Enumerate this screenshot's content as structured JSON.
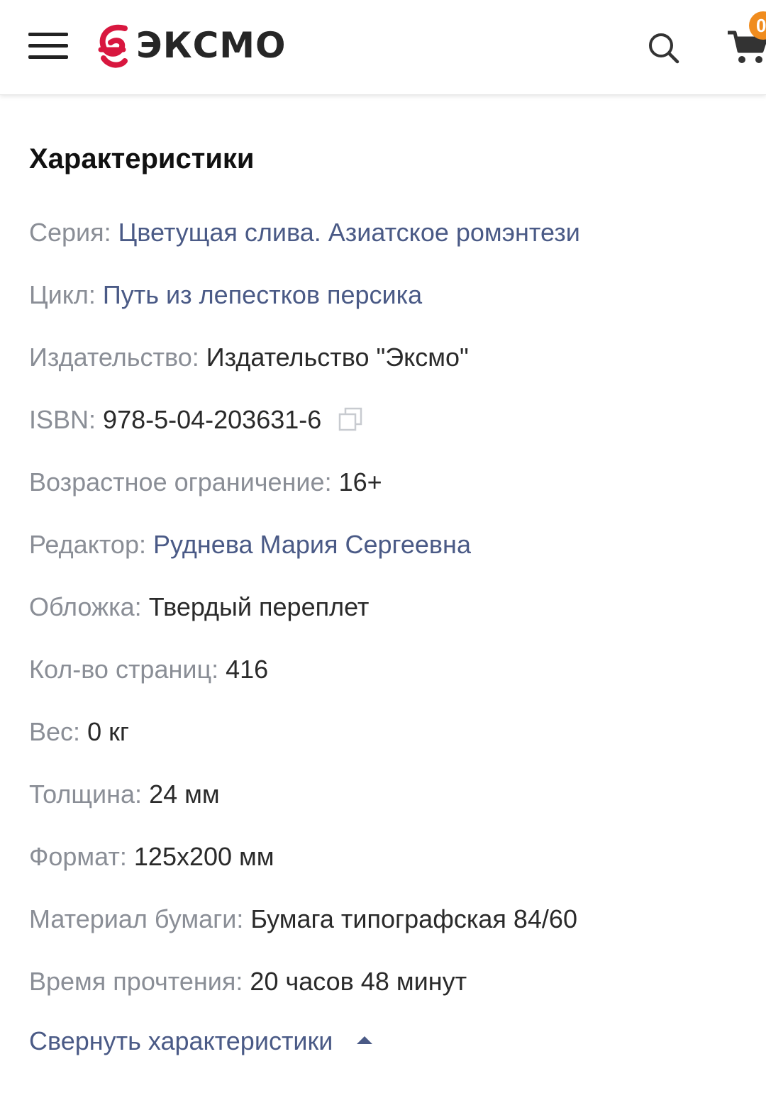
{
  "header": {
    "logo_text": "ЭКСМО",
    "cart_count": "0"
  },
  "characteristics": {
    "title": "Характеристики",
    "items": [
      {
        "label": "Серия:",
        "value": "Цветущая слива. Азиатское ромэнтези",
        "link": true
      },
      {
        "label": "Цикл:",
        "value": "Путь из лепестков персика",
        "link": true
      },
      {
        "label": "Издательство:",
        "value": "Издательство \"Эксмо\"",
        "link": false
      },
      {
        "label": "ISBN:",
        "value": "978-5-04-203631-6",
        "link": false
      },
      {
        "label": "Возрастное ограничение:",
        "value": "16+",
        "link": false
      },
      {
        "label": "Редактор:",
        "value": "Руднева Мария Сергеевна",
        "link": true
      },
      {
        "label": "Обложка:",
        "value": "Твердый переплет",
        "link": false
      },
      {
        "label": "Кол-во страниц:",
        "value": "416",
        "link": false
      },
      {
        "label": "Вес:",
        "value": "0 кг",
        "link": false
      },
      {
        "label": "Толщина:",
        "value": "24 мм",
        "link": false
      },
      {
        "label": "Формат:",
        "value": "125x200 мм",
        "link": false
      },
      {
        "label": "Материал бумаги:",
        "value": "Бумага типографская 84/60",
        "link": false
      },
      {
        "label": "Время прочтения:",
        "value": "20 часов 48 минут",
        "link": false
      }
    ],
    "collapse_label": "Свернуть характеристики"
  },
  "colors": {
    "brand_red": "#d8173f",
    "label_gray": "#8a8e96",
    "link_blue": "#4a5a86",
    "badge_orange": "#f08c1e"
  },
  "icons": [
    "menu-icon",
    "search-icon",
    "cart-icon",
    "copy-icon",
    "caret-up-icon"
  ]
}
